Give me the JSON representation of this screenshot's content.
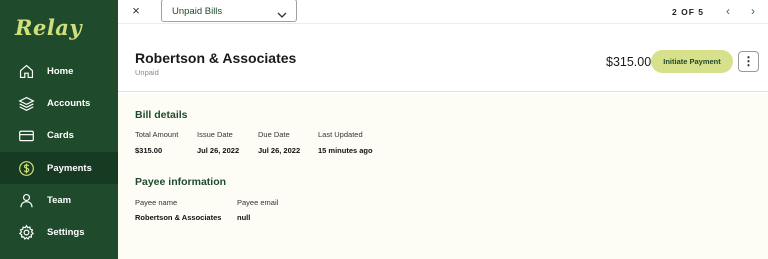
{
  "app": {
    "logo": "Relay"
  },
  "sidebar": {
    "items": [
      {
        "label": "Home",
        "icon": "home-icon",
        "active": false
      },
      {
        "label": "Accounts",
        "icon": "layers-icon",
        "active": false
      },
      {
        "label": "Cards",
        "icon": "card-icon",
        "active": false
      },
      {
        "label": "Payments",
        "icon": "dollar-icon",
        "active": true
      },
      {
        "label": "Team",
        "icon": "user-icon",
        "active": false
      },
      {
        "label": "Settings",
        "icon": "gear-icon",
        "active": false
      }
    ]
  },
  "topbar": {
    "close_icon": "×",
    "filter_select": "Unpaid Bills",
    "pager": "2 OF 5",
    "prev_icon": "‹",
    "next_icon": "›"
  },
  "bill": {
    "vendor": "Robertson & Associates",
    "status": "Unpaid",
    "amount": "$315.00",
    "pay_button": "Initiate Payment",
    "more_icon": "⋮"
  },
  "bill_details": {
    "title": "Bill details",
    "fields": [
      {
        "label": "Total Amount",
        "value": "$315.00"
      },
      {
        "label": "Issue Date",
        "value": "Jul 26, 2022"
      },
      {
        "label": "Due Date",
        "value": "Jul 26, 2022"
      },
      {
        "label": "Last Updated",
        "value": "15 minutes ago"
      }
    ]
  },
  "payee_info": {
    "title": "Payee information",
    "fields": [
      {
        "label": "Payee name",
        "value": "Robertson & Associates"
      },
      {
        "label": "Payee email",
        "value": "null"
      }
    ]
  },
  "colors": {
    "sidebar": "#1f4a2c",
    "sidebar_active": "#173b22",
    "accent": "#d7e08a",
    "logo": "#cfe07a"
  }
}
